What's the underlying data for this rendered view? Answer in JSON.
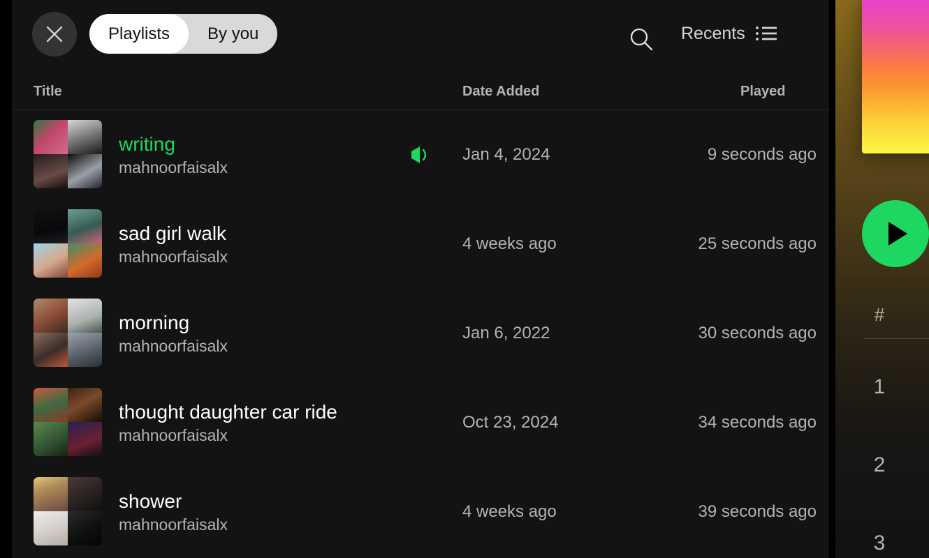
{
  "background_page": {
    "play_button_label": "play",
    "track_number_header": "#",
    "track_numbers": [
      "1",
      "2",
      "3"
    ],
    "colors": {
      "accent_green": "#1ed760",
      "cover_top": "#e83fd2",
      "cover_mid": "#fb7a44",
      "cover_bottom": "#fcf943",
      "page_bg_top": "#8a6a1c"
    }
  },
  "panel": {
    "close_label": "Close",
    "close_icon": "close-icon",
    "segmented": {
      "options": [
        {
          "label": "Playlists",
          "active": true
        },
        {
          "label": "By you",
          "active": false
        }
      ]
    },
    "search_icon": "search-icon",
    "sort": {
      "label": "Recents",
      "icon": "list-view-icon"
    },
    "columns": {
      "title": "Title",
      "date_added": "Date Added",
      "played": "Played"
    },
    "rows": [
      {
        "title": "writing",
        "owner": "mahnoorfaisalx",
        "date_added": "Jan 4, 2024",
        "played": "9 seconds ago",
        "is_playing": true,
        "playing_icon": "speaker-playing-icon",
        "thumb_colors": [
          "#b0455f",
          "#8d8d8d",
          "#2a2225",
          "#6f7278"
        ]
      },
      {
        "title": "sad girl walk",
        "owner": "mahnoorfaisalx",
        "date_added": "4 weeks ago",
        "played": "25 seconds ago",
        "is_playing": false,
        "thumb_colors": [
          "#0e0e10",
          "#5d8b82",
          "#88c2d6",
          "#c0552a"
        ]
      },
      {
        "title": "morning",
        "owner": "mahnoorfaisalx",
        "date_added": "Jan 6, 2022",
        "played": "30 seconds ago",
        "is_playing": false,
        "thumb_colors": [
          "#9a7157",
          "#cfd3d2",
          "#6f5a53",
          "#767c84"
        ]
      },
      {
        "title": "thought daughter car ride",
        "owner": "mahnoorfaisalx",
        "date_added": "Oct 23, 2024",
        "played": "34 seconds ago",
        "is_playing": false,
        "thumb_colors": [
          "#b24a33",
          "#2a1d17",
          "#4a6b3c",
          "#3b1f38"
        ]
      },
      {
        "title": "shower",
        "owner": "mahnoorfaisalx",
        "date_added": "4 weeks ago",
        "played": "39 seconds ago",
        "is_playing": false,
        "thumb_colors": [
          "#d4c07a",
          "#2b2224",
          "#e6e4e0",
          "#1b1b1b"
        ]
      }
    ]
  }
}
